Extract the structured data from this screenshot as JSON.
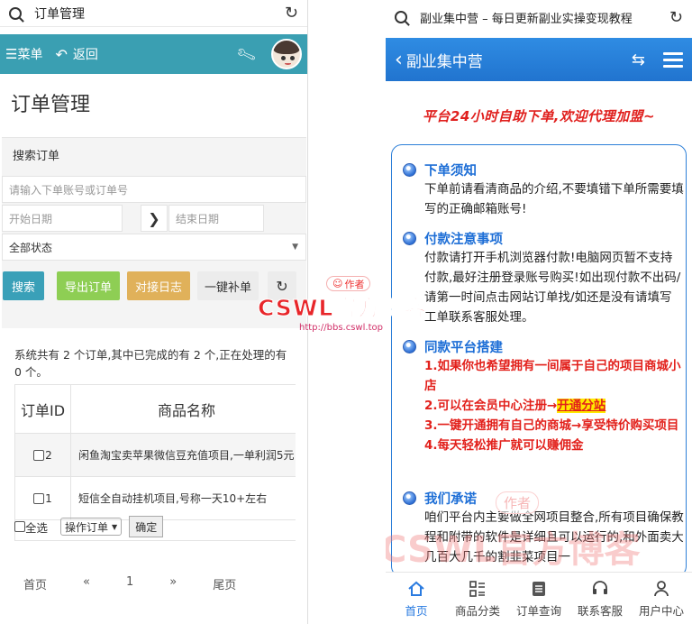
{
  "left": {
    "url_title": "订单管理",
    "header": {
      "menu_label": "菜单",
      "back_label": "返回"
    },
    "page_title": "订单管理",
    "search": {
      "heading": "搜索订单",
      "keyword_placeholder": "请输入下单账号或订单号",
      "start_date_placeholder": "开始日期",
      "end_date_placeholder": "结束日期",
      "status_value": "全部状态",
      "buttons": {
        "search": "搜索",
        "export": "导出订单",
        "dock_log": "对接日志",
        "refill": "一键补单"
      }
    },
    "stats_text": "系统共有 2 个订单,其中已完成的有 2 个,正在处理的有 0 个。",
    "table": {
      "headers": [
        "订单ID",
        "商品名称"
      ],
      "rows": [
        {
          "id": "2",
          "name": "闲鱼淘宝卖苹果微信豆充值项目,一单利润5元"
        },
        {
          "id": "1",
          "name": "短信全自动挂机项目,号称一天10+左右"
        }
      ]
    },
    "bulk": {
      "select_all": "全选",
      "action_select": "操作订单",
      "confirm": "确定"
    },
    "pager": {
      "first": "首页",
      "prev": "«",
      "current": "1",
      "next": "»",
      "last": "尾页"
    }
  },
  "watermark": {
    "badge": "作者",
    "text": "CSWL官方博客",
    "url": "http://bbs.cswl.top"
  },
  "right": {
    "url_title": "副业集中营 – 每日更新副业实操变现教程",
    "header_title": "副业集中营",
    "slogan": "平台24小时自助下单,欢迎代理加盟~",
    "sections": [
      {
        "title": "下单须知",
        "body": "下单前请看清商品的介绍,不要填错下单所需要填写的正确邮箱账号!"
      },
      {
        "title": "付款注意事项",
        "body": "付款请打开手机浏览器付款!电脑网页暂不支持付款,最好注册登录账号购买!如出现付款不出码/请第一时间点击网站订单找/如还是没有请填写工单联系客服处理。"
      },
      {
        "title": "同款平台搭建",
        "line1": "1.如果你也希望拥有一间属于自己的项目商城小店",
        "line2_pre": "2.可以在会员中心注册→",
        "line2_link": "开通分站",
        "line3": "3.一键开通拥有自己的商城→享受特价购买项目",
        "line4": "4.每天轻松推广就可以赚佣金"
      },
      {
        "title": "我们承诺",
        "body": "咱们平台内主要做全网项目整合,所有项目确保教程和附带的软件是详细且可以运行的,和外面卖大几百大几千的割韭菜项目一"
      }
    ],
    "tabs": [
      "首页",
      "商品分类",
      "订单查询",
      "联系客服",
      "用户中心"
    ]
  }
}
